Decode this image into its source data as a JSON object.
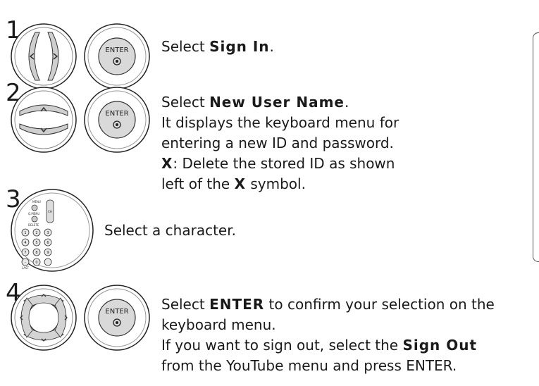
{
  "steps": [
    {
      "number": "1",
      "buttons": [
        "left-right-nav",
        "enter"
      ],
      "lines": [
        {
          "pre": "Select ",
          "bold": "Sign In",
          "post": "."
        }
      ]
    },
    {
      "number": "2",
      "buttons": [
        "up-down-nav",
        "enter"
      ],
      "lines": [
        {
          "pre": "Select ",
          "bold": "New User Name",
          "post": "."
        },
        {
          "pre": "It displays the keyboard menu for",
          "bold": "",
          "post": ""
        },
        {
          "pre": "entering a new ID and password.",
          "bold": "",
          "post": ""
        },
        {
          "pre": "",
          "bold": "X",
          "post": ": Delete the stored ID as shown"
        },
        {
          "pre": "left of the ",
          "bold": "X",
          "post": " symbol."
        }
      ]
    },
    {
      "number": "3",
      "buttons": [
        "number-keypad"
      ],
      "lines": [
        {
          "pre": "Select a character.",
          "bold": "",
          "post": ""
        }
      ]
    },
    {
      "number": "4",
      "buttons": [
        "four-way-nav",
        "enter"
      ],
      "lines": [
        {
          "pre": "Select ",
          "bold": "ENTER",
          "post": " to confirm your selection on the"
        },
        {
          "pre": "keyboard menu.",
          "bold": "",
          "post": ""
        },
        {
          "pre": "If you want to sign out, select the ",
          "bold": "Sign Out",
          "post": ""
        },
        {
          "pre": "from the YouTube menu and press ENTER.",
          "bold": "",
          "post": ""
        }
      ]
    }
  ],
  "enter_button_label": "ENTER",
  "keypad_labels": {
    "menu": "MENU",
    "channel": "CH",
    "delete": "DELETE",
    "last": "LAST"
  }
}
